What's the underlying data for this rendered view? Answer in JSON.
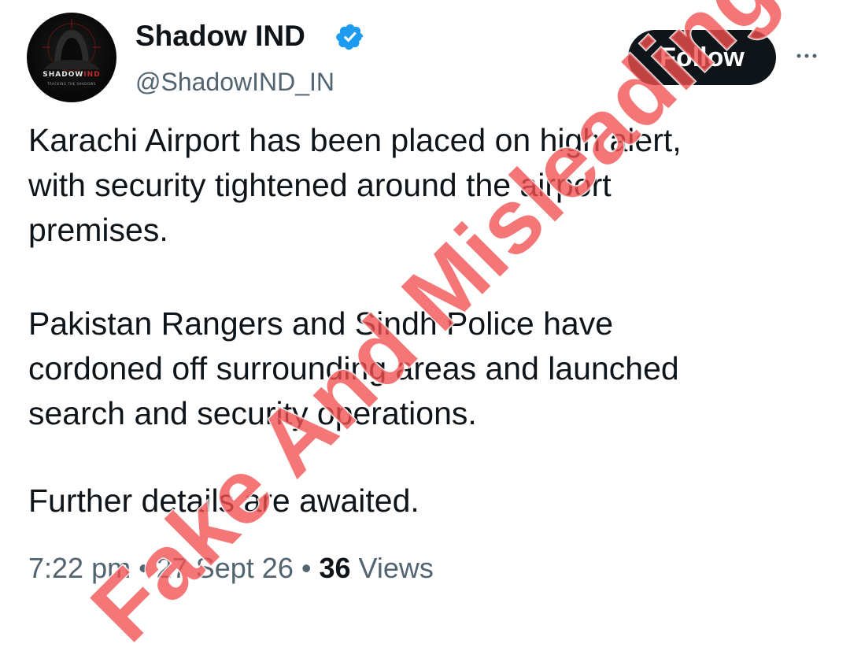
{
  "author": {
    "display_name": "Shadow IND",
    "handle": "@ShadowIND_IN",
    "verified": true,
    "avatar": {
      "icon": "hooded-figure-logo",
      "wordmark_primary": "SHADOW",
      "wordmark_accent": "IND",
      "tagline": "TRACKING THE SHADOWS"
    }
  },
  "actions": {
    "follow_label": "Follow",
    "more_icon": "more-options-icon"
  },
  "tweet": {
    "paragraphs": [
      [
        "Karachi Airport has been placed on high alert,",
        "with security tightened around the airport",
        "premises."
      ],
      [
        "Pakistan Rangers and Sindh Police have",
        "cordoned off surrounding areas and launched",
        "search and security operations."
      ],
      [
        "Further details are awaited."
      ]
    ]
  },
  "meta": {
    "time": "7:22 pm",
    "separator": " • ",
    "date": "27 Sept 26",
    "views_count": "36",
    "views_label": " Views"
  },
  "stamp": {
    "text": "Fake And Misleading",
    "color": "#f25050"
  },
  "colors": {
    "text_primary": "#0f1419",
    "text_secondary": "#536471",
    "verified_blue": "#1d9bf0",
    "button_bg": "#0f1419"
  }
}
